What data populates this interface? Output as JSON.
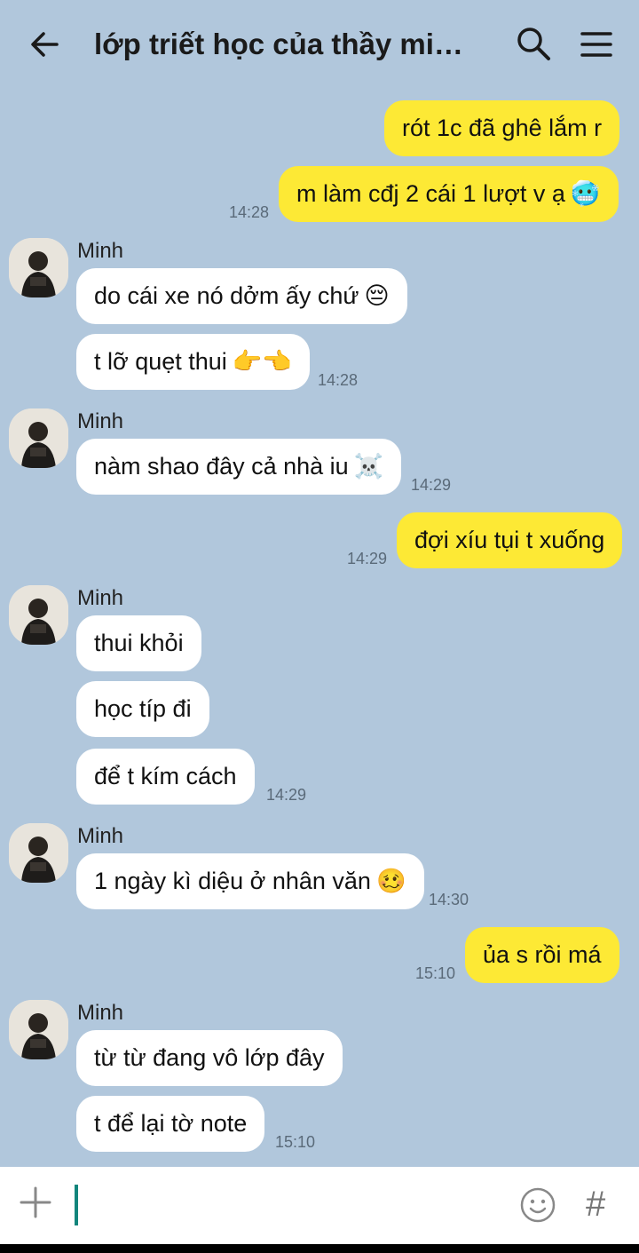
{
  "header": {
    "title": "lớp triết học của thầy min...",
    "back_icon": "arrow-left-icon",
    "search_icon": "search-icon",
    "menu_icon": "hamburger-menu-icon"
  },
  "messages": [
    {
      "text": "rót 1c đã ghê lắm r",
      "dir": "out"
    },
    {
      "text": "m làm cđj 2 cái 1 lượt v ạ",
      "emoji": "🥶",
      "dir": "out",
      "time": "14:28"
    },
    {
      "sender": "Minh"
    },
    {
      "text": "do cái xe nó dởm ấy chứ",
      "emoji": "😔",
      "dir": "in"
    },
    {
      "text": "t lỡ quẹt thui",
      "emoji": "👉👈",
      "dir": "in",
      "time": "14:28"
    },
    {
      "sender": "Minh"
    },
    {
      "text": "nàm shao đây cả nhà iu",
      "emoji": "☠️",
      "dir": "in",
      "time": "14:29"
    },
    {
      "text": "đợi xíu tụi t xuống",
      "dir": "out",
      "time": "14:29"
    },
    {
      "sender": "Minh"
    },
    {
      "text": "thui khỏi",
      "dir": "in"
    },
    {
      "text": "học típ đi",
      "dir": "in"
    },
    {
      "text": "để t kím cách",
      "dir": "in",
      "time": "14:29"
    },
    {
      "sender": "Minh"
    },
    {
      "text": "1 ngày kì diệu ở nhân văn",
      "emoji": "🥴",
      "dir": "in",
      "time": "14:30"
    },
    {
      "text": "ủa s rồi má",
      "dir": "out",
      "time": "15:10"
    },
    {
      "sender": "Minh"
    },
    {
      "text": "từ từ đang vô lớp đây",
      "dir": "in"
    },
    {
      "text": "t để lại tờ note",
      "dir": "in",
      "time": "15:10"
    }
  ],
  "input_bar": {
    "plus_icon": "plus-icon",
    "emoji_icon": "smiley-icon",
    "hash_label": "#"
  }
}
